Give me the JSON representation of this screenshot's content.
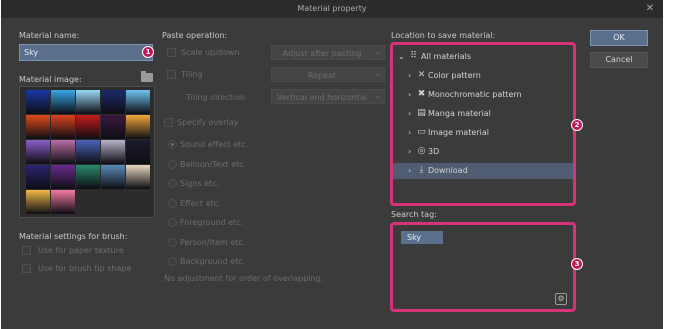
{
  "dialog": {
    "title": "Material property",
    "close_glyph": "✕"
  },
  "name": {
    "label": "Material name:",
    "value": "Sky",
    "badge": "1"
  },
  "image": {
    "label": "Material image:",
    "icon": "folder-open-icon",
    "swatches": [
      [
        "#1b3aa8",
        "#38a7e8",
        "#9bd8f5",
        "#1d2a6b",
        "#6fc3f0"
      ],
      [
        "#e04a1a",
        "#d9431e",
        "#c61c1c",
        "#3a1a3d",
        "#f2a83a"
      ],
      [
        "#8c5fc8",
        "#b86fa6",
        "#4c63b8",
        "#b9b3c8",
        "#1c1c2c"
      ],
      [
        "#2c2470",
        "#6a2c8c",
        "#2a8a6a",
        "#5a8ab8",
        "#e8d8c0"
      ],
      [
        "#f0b848",
        "#f27aa0",
        "",
        "",
        ""
      ]
    ]
  },
  "brush": {
    "label": "Material settings for brush:",
    "paper_texture": "Use for paper texture",
    "brush_tip": "Use for brush tip shape"
  },
  "paste": {
    "label": "Paste operation:",
    "scale": "Scale up/down",
    "scale_mode": "Adjust after pasting",
    "tiling": "Tiling",
    "tiling_mode": "Repeat",
    "tiling_direction_label": "Tiling direction",
    "tiling_direction": "Vertical and horizontal",
    "specify_overlay": "Specify overlay",
    "overlay_options": [
      "Sound effect etc.",
      "Balloon/Text etc.",
      "Signs etc.",
      "Effect etc.",
      "Foreground etc.",
      "Person/Item etc.",
      "Background etc."
    ],
    "no_adjust_note": "No adjustment for order of overlapping.",
    "arrow": "⌄"
  },
  "location": {
    "label": "Location to save material:",
    "badge": "2",
    "root": "All materials",
    "items": [
      {
        "label": "Color pattern",
        "icon": "color-pattern-icon",
        "glyph": "✕"
      },
      {
        "label": "Monochromatic pattern",
        "icon": "mono-pattern-icon",
        "glyph": "✖"
      },
      {
        "label": "Manga material",
        "icon": "manga-icon",
        "glyph": "▤"
      },
      {
        "label": "Image material",
        "icon": "image-icon",
        "glyph": "▭"
      },
      {
        "label": "3D",
        "icon": "3d-icon",
        "glyph": "◎"
      },
      {
        "label": "Download",
        "icon": "download-icon",
        "glyph": "⤓"
      }
    ],
    "selected_index": 5
  },
  "search": {
    "label": "Search tag:",
    "tag": "Sky",
    "badge": "3"
  },
  "buttons": {
    "ok": "OK",
    "cancel": "Cancel"
  }
}
